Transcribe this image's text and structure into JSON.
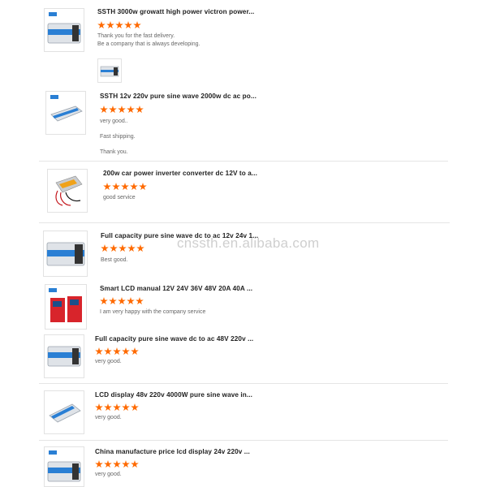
{
  "reviews": [
    {
      "title": "SSTH 3000w growatt high power victron power...",
      "stars": 5,
      "lines": [
        "Thank you for the fast delivery.",
        "Be a company that is always developing."
      ]
    },
    {
      "title": "SSTH 12v 220v pure sine wave 2000w dc ac po...",
      "stars": 5,
      "lines": [
        "very good..",
        "Fast shipping.",
        "Thank you."
      ]
    },
    {
      "title": "200w car power inverter converter dc 12V to a...",
      "stars": 5,
      "lines": [
        "good service"
      ]
    },
    {
      "title": "Full capacity pure sine wave dc to ac 12v 24v 1...",
      "stars": 5,
      "lines": [
        "Best good."
      ]
    },
    {
      "title": "Smart LCD manual 12V 24V 36V 48V 20A 40A ...",
      "stars": 5,
      "lines": [
        "I am very happy with the company service"
      ]
    },
    {
      "title": "Full capacity pure sine wave dc to ac 48V 220v ...",
      "stars": 5,
      "lines": [
        "very good."
      ]
    },
    {
      "title": "LCD display 48v 220v 4000W pure sine wave in...",
      "stars": 5,
      "lines": [
        "very good."
      ]
    },
    {
      "title": "China manufacture price lcd display 24v 220v ...",
      "stars": 5,
      "lines": [
        "very good."
      ]
    }
  ],
  "watermark": "cnssth.en.alibaba.com",
  "colors": {
    "star": "#ff6a00",
    "inverter_blue": "#2a7fd4",
    "controller_red": "#d8242b"
  },
  "icons": {
    "thumb0": "inverter-icon",
    "thumb1": "inverter-icon",
    "thumb2": "car-inverter-icon",
    "thumb3": "inverter-icon",
    "thumb4": "charge-controller-icon",
    "thumb5": "inverter-icon",
    "thumb6": "inverter-icon",
    "thumb7": "inverter-icon"
  }
}
